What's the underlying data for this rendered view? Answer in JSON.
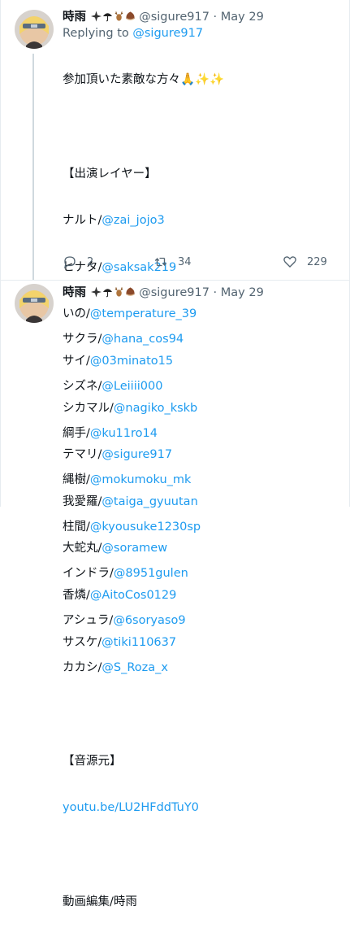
{
  "tweets": [
    {
      "display_name": "時雨",
      "name_emoji": [
        "sparkle-icon",
        "umbrella-icon",
        "deer-icon",
        "chestnut-icon"
      ],
      "handle": "@sigure917",
      "separator": "·",
      "date": "May 29",
      "replying_prefix": "Replying to",
      "replying_to": "@sigure917",
      "lines": [
        {
          "text": "参加頂いた素敵な方々🙏✨✨",
          "link": ""
        },
        {
          "text": "",
          "link": ""
        },
        {
          "text": "【出演レイヤー】",
          "link": ""
        },
        {
          "text": "ナルト/",
          "link": "@zai_jojo3"
        },
        {
          "text": "ヒナタ/",
          "link": "@saksak219"
        },
        {
          "text": "いの/",
          "link": "@temperature_39"
        },
        {
          "text": "サイ/",
          "link": "@03minato15"
        },
        {
          "text": "シカマル/",
          "link": "@nagiko_kskb"
        },
        {
          "text": "テマリ/",
          "link": "@sigure917"
        },
        {
          "text": "我愛羅/",
          "link": "@taiga_gyuutan"
        },
        {
          "text": "大蛇丸/",
          "link": "@soramew"
        },
        {
          "text": "香燐/",
          "link": "@AitoCos0129"
        },
        {
          "text": "サスケ/",
          "link": "@tiki110637"
        }
      ],
      "actions": {
        "reply_count": "2",
        "retweet_count": "34",
        "like_count": "229"
      }
    },
    {
      "display_name": "時雨",
      "name_emoji": [
        "sparkle-icon",
        "umbrella-icon",
        "deer-icon",
        "chestnut-icon"
      ],
      "handle": "@sigure917",
      "separator": "·",
      "date": "May 29",
      "lines": [
        {
          "text": "サクラ/",
          "link": "@hana_cos94"
        },
        {
          "text": "シズネ/",
          "link": "@Leiiii000"
        },
        {
          "text": "綱手/",
          "link": "@ku11ro14"
        },
        {
          "text": "縄樹/",
          "link": "@mokumoku_mk"
        },
        {
          "text": "柱間/",
          "link": "@kyousuke1230sp"
        },
        {
          "text": "インドラ/",
          "link": "@8951gulen"
        },
        {
          "text": "アシュラ/",
          "link": "@6soryaso9"
        },
        {
          "text": "カカシ/",
          "link": "@S_Roza_x"
        },
        {
          "text": "",
          "link": ""
        },
        {
          "text": "【音源元】",
          "link": ""
        },
        {
          "text": "",
          "link": "youtu.be/LU2HFddTuY0"
        },
        {
          "text": "",
          "link": ""
        },
        {
          "text": "動画編集/時雨",
          "link": ""
        }
      ]
    }
  ],
  "colors": {
    "link": "#1d9bf0",
    "secondary": "#536471",
    "text": "#0f1419",
    "divider": "#e6ecf0"
  }
}
